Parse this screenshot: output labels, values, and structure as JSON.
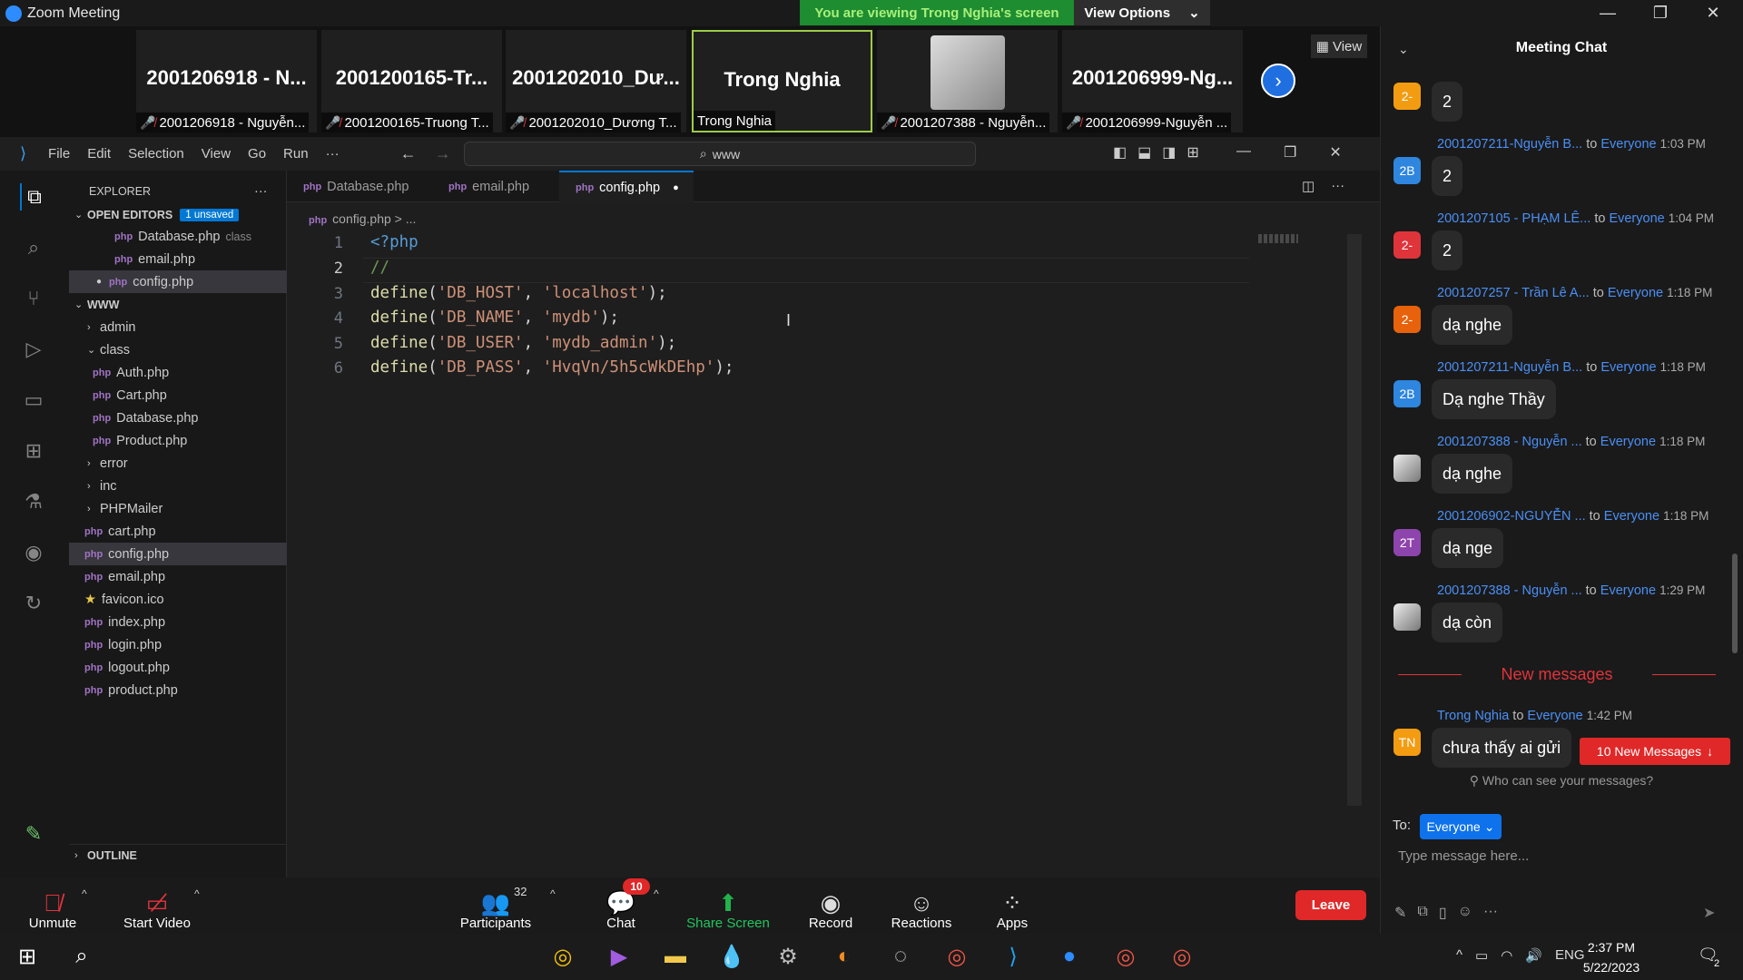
{
  "zoom": {
    "window_title": "Zoom Meeting",
    "viewing_banner": "You are viewing Trong Nghia's screen",
    "view_options": "View Options",
    "view_button": "View",
    "participants": [
      {
        "big": "2001206918 - N...",
        "small": "2001206918 - Nguyễn..."
      },
      {
        "big": "2001200165-Tr...",
        "small": "2001200165-Truong T..."
      },
      {
        "big": "2001202010_Dư...",
        "small": "2001202010_Dương T..."
      },
      {
        "big": "Trong Nghia",
        "small": "Trong Nghia"
      },
      {
        "big": "",
        "small": "2001207388 - Nguyễn..."
      },
      {
        "big": "2001206999-Ng...",
        "small": "2001206999-Nguyễn ..."
      }
    ],
    "controls": {
      "unmute": "Unmute",
      "start_video": "Start Video",
      "participants": "Participants",
      "participants_count": "32",
      "chat": "Chat",
      "chat_badge": "10",
      "share_screen": "Share Screen",
      "record": "Record",
      "reactions": "Reactions",
      "apps": "Apps",
      "leave": "Leave"
    }
  },
  "vscode": {
    "menu": [
      "File",
      "Edit",
      "Selection",
      "View",
      "Go",
      "Run",
      "···"
    ],
    "search": "www",
    "explorer_title": "EXPLORER",
    "open_editors": "OPEN EDITORS",
    "unsaved_badge": "1 unsaved",
    "open_files": [
      {
        "name": "Database.php",
        "desc": "class"
      },
      {
        "name": "email.php",
        "desc": ""
      },
      {
        "name": "config.php",
        "desc": ""
      }
    ],
    "folder": "WWW",
    "tree": [
      {
        "name": "admin",
        "type": "folder-closed",
        "indent": 1
      },
      {
        "name": "class",
        "type": "folder-open",
        "indent": 1
      },
      {
        "name": "Auth.php",
        "type": "php",
        "indent": 2
      },
      {
        "name": "Cart.php",
        "type": "php",
        "indent": 2
      },
      {
        "name": "Database.php",
        "type": "php",
        "indent": 2
      },
      {
        "name": "Product.php",
        "type": "php",
        "indent": 2
      },
      {
        "name": "error",
        "type": "folder-closed",
        "indent": 1
      },
      {
        "name": "inc",
        "type": "folder-closed",
        "indent": 1
      },
      {
        "name": "PHPMailer",
        "type": "folder-closed",
        "indent": 1
      },
      {
        "name": "cart.php",
        "type": "php",
        "indent": 1
      },
      {
        "name": "config.php",
        "type": "php",
        "indent": 1
      },
      {
        "name": "email.php",
        "type": "php",
        "indent": 1
      },
      {
        "name": "favicon.ico",
        "type": "star",
        "indent": 1
      },
      {
        "name": "index.php",
        "type": "php",
        "indent": 1
      },
      {
        "name": "login.php",
        "type": "php",
        "indent": 1
      },
      {
        "name": "logout.php",
        "type": "php",
        "indent": 1
      },
      {
        "name": "product.php",
        "type": "php",
        "indent": 1
      }
    ],
    "outline": "OUTLINE",
    "tabs": [
      "Database.php",
      "email.php",
      "config.php"
    ],
    "breadcrumb": "config.php > ...",
    "code_lines": [
      {
        "n": "1",
        "parts": [
          [
            "kw",
            "<?php"
          ]
        ]
      },
      {
        "n": "2",
        "parts": [
          [
            "cm",
            "//"
          ]
        ]
      },
      {
        "n": "3",
        "parts": [
          [
            "fn",
            "define"
          ],
          [
            "",
            "("
          ],
          [
            "str",
            "'DB_HOST'"
          ],
          [
            "",
            ", "
          ],
          [
            "str",
            "'localhost'"
          ],
          [
            "",
            ");"
          ]
        ]
      },
      {
        "n": "4",
        "parts": [
          [
            "fn",
            "define"
          ],
          [
            "",
            "("
          ],
          [
            "str",
            "'DB_NAME'"
          ],
          [
            "",
            ", "
          ],
          [
            "str",
            "'mydb'"
          ],
          [
            "",
            ");"
          ]
        ]
      },
      {
        "n": "5",
        "parts": [
          [
            "fn",
            "define"
          ],
          [
            "",
            "("
          ],
          [
            "str",
            "'DB_USER'"
          ],
          [
            "",
            ", "
          ],
          [
            "str",
            "'mydb_admin'"
          ],
          [
            "",
            ");"
          ]
        ]
      },
      {
        "n": "6",
        "parts": [
          [
            "fn",
            "define"
          ],
          [
            "",
            "("
          ],
          [
            "str",
            "'DB_PASS'"
          ],
          [
            "",
            ", "
          ],
          [
            "str",
            "'HvqVn/5h5cWkDEhp'"
          ],
          [
            "",
            ");"
          ]
        ]
      }
    ]
  },
  "chat": {
    "title": "Meeting Chat",
    "messages": [
      {
        "sender": "",
        "to": "",
        "time": "",
        "avatar": "2-",
        "avatar_color": "#f39c12",
        "text": "2"
      },
      {
        "sender": "2001207211-Nguyễn B...",
        "to": "Everyone",
        "time": "1:03 PM",
        "avatar": "2B",
        "avatar_color": "#2e86de",
        "text": "2"
      },
      {
        "sender": "2001207105 - PHẠM LÊ...",
        "to": "Everyone",
        "time": "1:04 PM",
        "avatar": "2-",
        "avatar_color": "#e0343b",
        "text": "2"
      },
      {
        "sender": "2001207257 - Trần Lê A...",
        "to": "Everyone",
        "time": "1:18 PM",
        "avatar": "2-",
        "avatar_color": "#e8620c",
        "text": "dạ nghe"
      },
      {
        "sender": "2001207211-Nguyễn B...",
        "to": "Everyone",
        "time": "1:18 PM",
        "avatar": "2B",
        "avatar_color": "#2e86de",
        "text": "Dạ nghe Thầy"
      },
      {
        "sender": "2001207388 - Nguyễn ...",
        "to": "Everyone",
        "time": "1:18 PM",
        "avatar": "",
        "avatar_color": "#777777",
        "text": "dạ nghe"
      },
      {
        "sender": "2001206902-NGUYỄN ...",
        "to": "Everyone",
        "time": "1:18 PM",
        "avatar": "2T",
        "avatar_color": "#8e44ad",
        "text": "dạ nge"
      },
      {
        "sender": "2001207388 - Nguyễn ...",
        "to": "Everyone",
        "time": "1:29 PM",
        "avatar": "",
        "avatar_color": "#777777",
        "text": "dạ còn"
      }
    ],
    "new_messages_divider": "New messages",
    "last_message": {
      "sender": "Trong Nghia",
      "to": "Everyone",
      "time": "1:42 PM",
      "avatar": "TN",
      "avatar_color": "#f39c12",
      "text": "chưa thấy ai gửi"
    },
    "to_word": "to",
    "new_messages_button": "10 New Messages",
    "who_can_see": "Who can see your messages?",
    "to_label": "To:",
    "recipient": "Everyone",
    "placeholder": "Type message here..."
  },
  "taskbar": {
    "lang": "ENG",
    "time": "2:37 PM",
    "date": "5/22/2023",
    "notif_count": "2"
  }
}
